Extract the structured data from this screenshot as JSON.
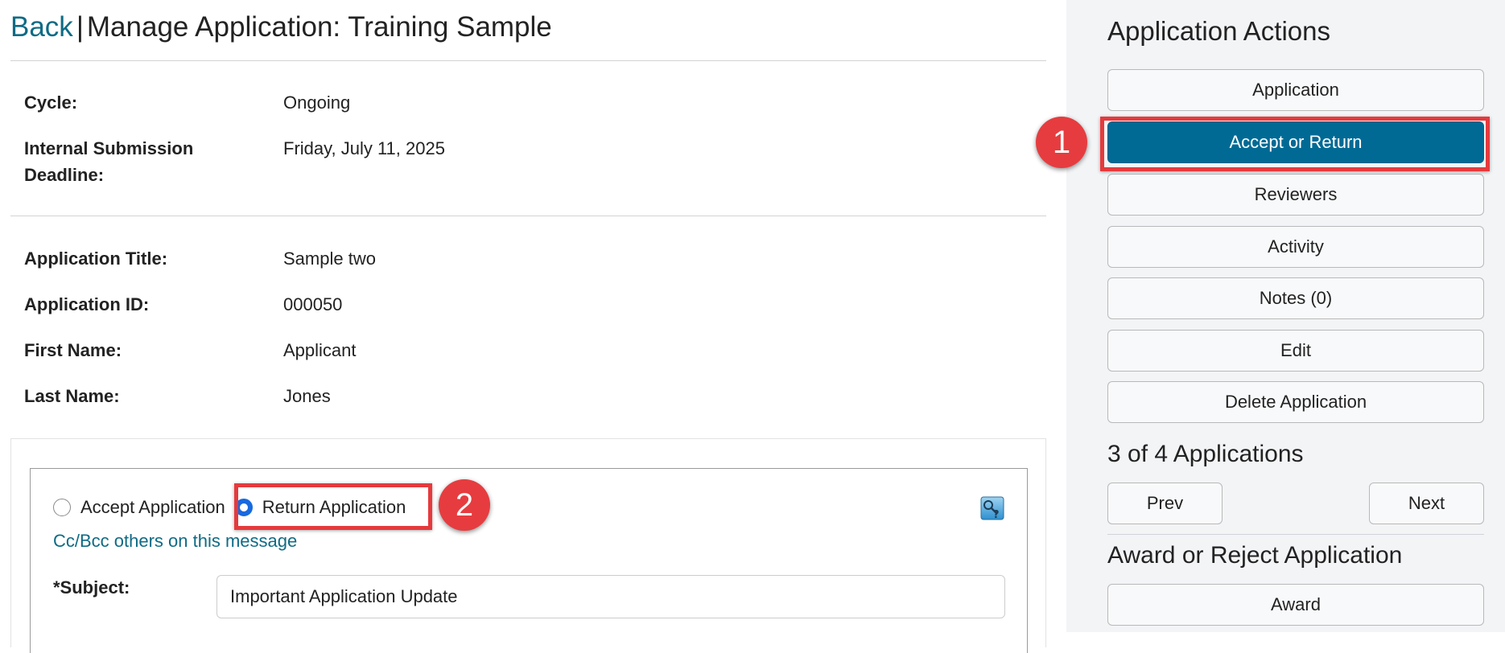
{
  "header": {
    "back_label": "Back",
    "separator": "|",
    "title": "Manage Application: Training Sample"
  },
  "details_top": [
    {
      "label": "Cycle:",
      "value": "Ongoing"
    },
    {
      "label": "Internal Submission Deadline:",
      "label_line1": "Internal Submission",
      "label_line2": "Deadline:",
      "value": "Friday, July 11, 2025"
    }
  ],
  "details_app": [
    {
      "label": "Application Title:",
      "value": "Sample two"
    },
    {
      "label": "Application ID:",
      "value": "000050"
    },
    {
      "label": "First Name:",
      "value": "Applicant"
    },
    {
      "label": "Last Name:",
      "value": "Jones"
    }
  ],
  "decision": {
    "accept_label": "Accept Application",
    "return_label": "Return Application",
    "selected": "return",
    "cc_link": "Cc/Bcc others on this message",
    "subject_label": "*Subject:",
    "subject_value": "Important Application Update"
  },
  "sidebar": {
    "actions_heading": "Application Actions",
    "actions": [
      {
        "label": "Application"
      },
      {
        "label": "Accept or Return",
        "active": true
      },
      {
        "label": "Reviewers"
      },
      {
        "label": "Activity"
      },
      {
        "label": "Notes (0)"
      },
      {
        "label": "Edit"
      },
      {
        "label": "Delete Application"
      }
    ],
    "paging_heading": "3 of 4 Applications",
    "prev_label": "Prev",
    "next_label": "Next",
    "award_heading": "Award or Reject Application",
    "award_label": "Award"
  },
  "callouts": {
    "one": "1",
    "two": "2"
  },
  "colors": {
    "link": "#0e6b85",
    "active_button": "#006a95",
    "callout_red": "#e53a3d",
    "radio_blue": "#1769e0"
  }
}
